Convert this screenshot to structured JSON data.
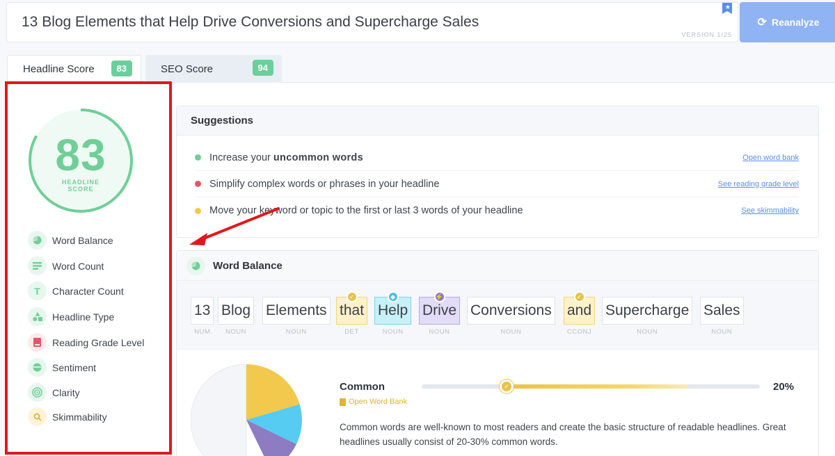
{
  "header": {
    "headline": "13 Blog Elements that Help Drive Conversions and Supercharge Sales",
    "version": "VERSION 1/25",
    "reanalyze_label": "Reanalyze"
  },
  "tabs": [
    {
      "label": "Headline Score",
      "score": "83"
    },
    {
      "label": "SEO Score",
      "score": "94"
    }
  ],
  "score": {
    "value": "83",
    "label_line1": "HEADLINE",
    "label_line2": "SCORE"
  },
  "metrics": [
    {
      "label": "Word Balance",
      "icon": "pie-chart-icon"
    },
    {
      "label": "Word Count",
      "icon": "lines-icon"
    },
    {
      "label": "Character Count",
      "icon": "letter-t-icon"
    },
    {
      "label": "Headline Type",
      "icon": "shapes-icon"
    },
    {
      "label": "Reading Grade Level",
      "icon": "book-icon"
    },
    {
      "label": "Sentiment",
      "icon": "face-icon"
    },
    {
      "label": "Clarity",
      "icon": "target-icon"
    },
    {
      "label": "Skimmability",
      "icon": "magnifier-icon"
    }
  ],
  "suggestions": {
    "title": "Suggestions",
    "items": [
      {
        "text_before": "Increase your ",
        "text_bold": "uncommon words",
        "text_after": "",
        "link": "Open word bank",
        "color": "#6fcf97"
      },
      {
        "text_before": "Simplify complex words or phrases in your headline",
        "text_bold": "",
        "text_after": "",
        "link": "See reading grade level",
        "color": "#e0566b"
      },
      {
        "text_before": "Move your keyword or topic to the first or last 3 words of your headline",
        "text_bold": "",
        "text_after": "",
        "link": "See skimmability",
        "color": "#f2c94c"
      }
    ]
  },
  "word_balance": {
    "title": "Word Balance",
    "words": [
      {
        "word": "13",
        "pos": "NUM"
      },
      {
        "word": "Blog",
        "pos": "NOUN"
      },
      {
        "word": "Elements",
        "pos": "NOUN"
      },
      {
        "word": "that",
        "pos": "DET"
      },
      {
        "word": "Help",
        "pos": "NOUN"
      },
      {
        "word": "Drive",
        "pos": "NOUN"
      },
      {
        "word": "Conversions",
        "pos": "NOUN"
      },
      {
        "word": "and",
        "pos": "CCONJ"
      },
      {
        "word": "Supercharge",
        "pos": "NOUN"
      },
      {
        "word": "Sales",
        "pos": "NOUN"
      }
    ],
    "common": {
      "title": "Common",
      "link": "Open Word Bank",
      "percent": "20%",
      "level": 0.2,
      "description": "Common words are well-known to most readers and create the basic structure of readable headlines. Great headlines usually consist of 20-30% common words."
    }
  },
  "colors": {
    "score_green": "#6fcf97",
    "common_yellow": "#f2c94c",
    "uncommon_cyan": "#56ccf2",
    "emotional_purple": "#8e7cc3",
    "highlight_red": "#e4161b",
    "accent_blue": "#5b8def"
  }
}
